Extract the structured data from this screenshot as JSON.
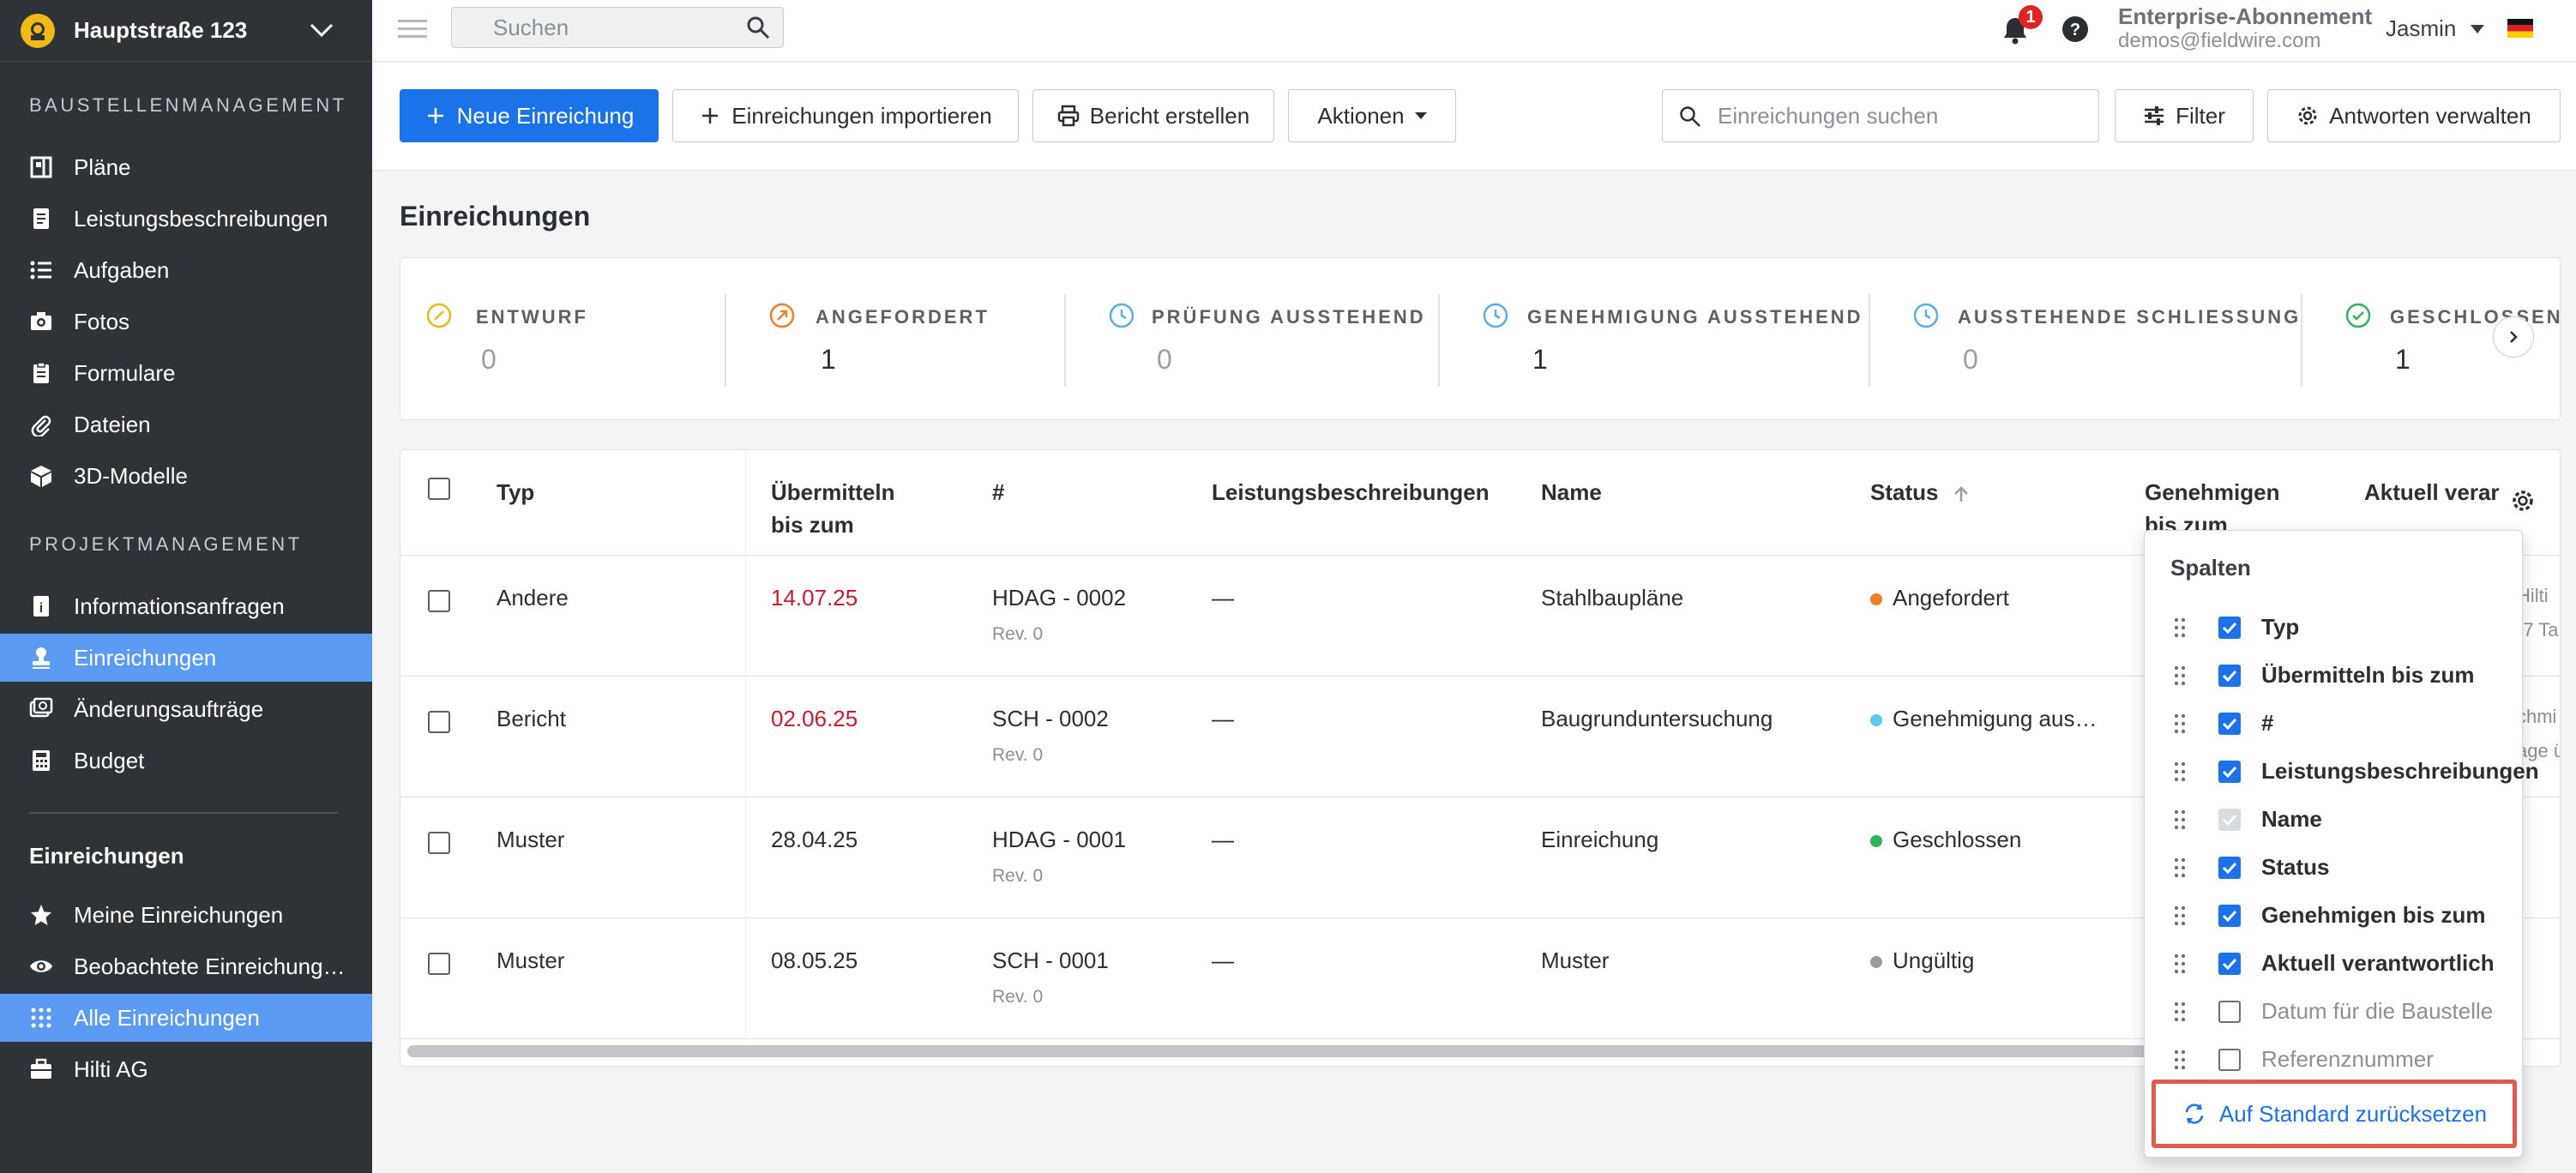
{
  "project": {
    "name": "Hauptstraße 123"
  },
  "sidebar": {
    "section_site": "BAUSTELLENMANAGEMENT",
    "section_project": "PROJEKTMANAGEMENT",
    "items": [
      {
        "label": "Pläne",
        "icon": "plans-icon"
      },
      {
        "label": "Leistungsbeschreibungen",
        "icon": "specs-icon"
      },
      {
        "label": "Aufgaben",
        "icon": "tasks-icon"
      },
      {
        "label": "Fotos",
        "icon": "camera-icon"
      },
      {
        "label": "Formulare",
        "icon": "forms-icon"
      },
      {
        "label": "Dateien",
        "icon": "paperclip-icon"
      },
      {
        "label": "3D-Modelle",
        "icon": "cube-icon"
      },
      {
        "label": "Informationsanfragen",
        "icon": "rfi-icon"
      },
      {
        "label": "Einreichungen",
        "icon": "stamp-icon"
      },
      {
        "label": "Änderungsaufträge",
        "icon": "change-order-icon"
      },
      {
        "label": "Budget",
        "icon": "calculator-icon"
      }
    ],
    "submissions_heading": "Einreichungen",
    "sub_items": [
      {
        "label": "Meine Einreichungen",
        "icon": "star-icon"
      },
      {
        "label": "Beobachtete Einreichung…",
        "icon": "eye-icon"
      },
      {
        "label": "Alle Einreichungen",
        "icon": "grid-icon"
      },
      {
        "label": "Hilti AG",
        "icon": "briefcase-icon"
      }
    ]
  },
  "topbar": {
    "search_placeholder": "Suchen",
    "notification_count": "1",
    "plan": "Enterprise-Abonnement",
    "email": "demos@fieldwire.com",
    "user": "Jasmin"
  },
  "toolbar": {
    "new": "Neue Einreichung",
    "import": "Einreichungen importieren",
    "report": "Bericht erstellen",
    "actions": "Aktionen",
    "search_placeholder": "Einreichungen suchen",
    "filter": "Filter",
    "manage": "Antworten verwalten"
  },
  "page_title": "Einreichungen",
  "status_strip": [
    {
      "label": "ENTWURF",
      "count": "0",
      "color": "#f2b817"
    },
    {
      "label": "ANGEFORDERT",
      "count": "1",
      "color": "#f07f2a"
    },
    {
      "label": "PRÜFUNG AUSSTEHEND",
      "count": "0",
      "color": "#5aaee8"
    },
    {
      "label": "GENEHMIGUNG AUSSTEHEND",
      "count": "1",
      "color": "#5aaee8"
    },
    {
      "label": "AUSSTEHENDE SCHLIESSUNG",
      "count": "0",
      "color": "#5aaee8"
    },
    {
      "label": "GESCHLOSSEN",
      "count": "1",
      "color": "#2fb35c"
    }
  ],
  "table": {
    "headers": {
      "type": "Typ",
      "submit_line1": "Übermitteln",
      "submit_line2": "bis zum",
      "number": "#",
      "specs": "Leistungsbeschreibungen",
      "name": "Name",
      "status": "Status",
      "approve_line1": "Genehmigen",
      "approve_line2": "bis zum",
      "responsible": "Aktuell verar"
    },
    "rows": [
      {
        "type": "Andere",
        "due": "14.07.25",
        "overdue": true,
        "number": "HDAG - 0002",
        "rev": "Rev. 0",
        "specs": "—",
        "name": "Stahlbaupläne",
        "status": "Angefordert",
        "status_color": "#f07f2a",
        "clip1": "Hilti",
        "clip2": "(7 Ta"
      },
      {
        "type": "Bericht",
        "due": "02.06.25",
        "overdue": true,
        "number": "SCH - 0002",
        "rev": "Rev. 0",
        "specs": "—",
        "name": "Baugrunduntersuchung",
        "status": "Genehmigung aus…",
        "status_color": "#5ac8f0",
        "clip1": "chmi",
        "clip2": "age ü"
      },
      {
        "type": "Muster",
        "due": "28.04.25",
        "overdue": false,
        "number": "HDAG - 0001",
        "rev": "Rev. 0",
        "specs": "—",
        "name": "Einreichung",
        "status": "Geschlossen",
        "status_color": "#2fb35c",
        "clip1": "",
        "clip2": ""
      },
      {
        "type": "Muster",
        "due": "08.05.25",
        "overdue": false,
        "number": "SCH - 0001",
        "rev": "Rev. 0",
        "specs": "—",
        "name": "Muster",
        "status": "Ungültig",
        "status_color": "#9a9ea3",
        "clip1": "",
        "clip2": ""
      }
    ]
  },
  "columns_popover": {
    "title": "Spalten",
    "options": [
      {
        "label": "Typ",
        "state": "on"
      },
      {
        "label": "Übermitteln bis zum",
        "state": "on"
      },
      {
        "label": "#",
        "state": "on"
      },
      {
        "label": "Leistungsbeschreibungen",
        "state": "on"
      },
      {
        "label": "Name",
        "state": "disabled"
      },
      {
        "label": "Status",
        "state": "on"
      },
      {
        "label": "Genehmigen bis zum",
        "state": "on"
      },
      {
        "label": "Aktuell verantwortlich",
        "state": "on"
      },
      {
        "label": "Datum für die Baustelle",
        "state": "off"
      },
      {
        "label": "Referenznummer",
        "state": "off"
      }
    ],
    "reset": "Auf Standard zurücksetzen"
  }
}
